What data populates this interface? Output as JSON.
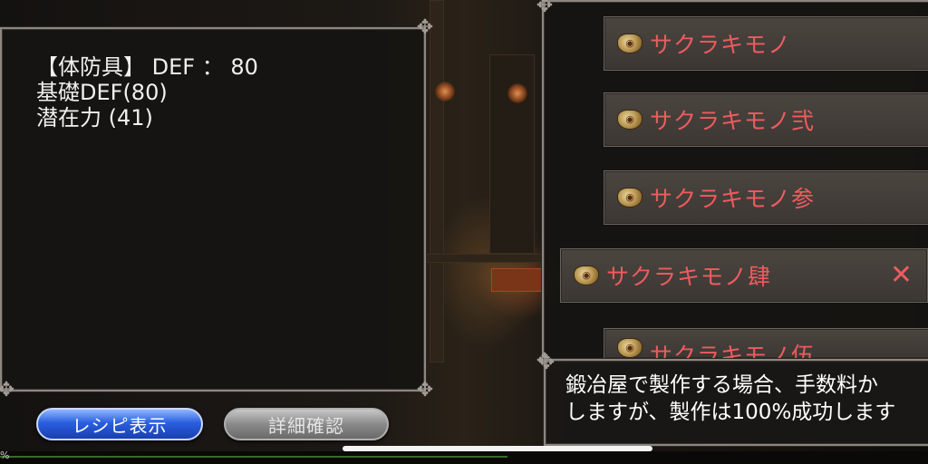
{
  "equipment": {
    "line1": "【体防具】 DEF ： 80",
    "line2": "基礎DEF(80)",
    "line3": "潜在力 (41)"
  },
  "items": [
    {
      "label": "サクラキモノ",
      "icon": "pouch-icon"
    },
    {
      "label": "サクラキモノ弐",
      "icon": "pouch-icon"
    },
    {
      "label": "サクラキモノ参",
      "icon": "pouch-icon"
    },
    {
      "label": "サクラキモノ肆",
      "icon": "pouch-icon",
      "selected": true,
      "action_icon": "close-icon",
      "action_symbol": "✕"
    },
    {
      "label": "サクラキモノ伍",
      "icon": "pouch-icon"
    }
  ],
  "message": {
    "line1": "鍛冶屋で製作する場合、手数料か",
    "line2": "しますが、製作は100%成功します"
  },
  "buttons": {
    "recipe": "レシピ表示",
    "detail": "詳細確認"
  },
  "status": {
    "percent_text": "%"
  },
  "colors": {
    "item_text": "#ef5b5f",
    "recipe_button": "#2a5fe0",
    "detail_button": "#8a8a8a"
  }
}
